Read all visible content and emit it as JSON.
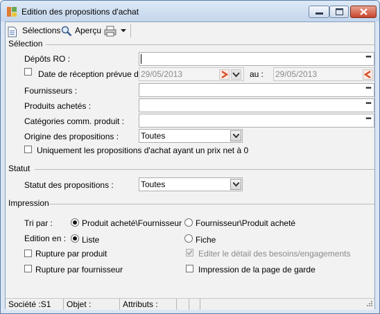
{
  "window": {
    "title": "Edition des propositions d'achat"
  },
  "toolbar": {
    "selections_label": "Sélections",
    "apercu_label": "Aperçu"
  },
  "selection": {
    "title": "Sélection",
    "depots_label": "Dépôts RO :",
    "depots_value": "",
    "date_checkbox_label": "Date de réception prévue du :",
    "date_from": "29/05/2013",
    "date_to_label": "au :",
    "date_to": "29/05/2013",
    "fournisseurs_label": "Fournisseurs :",
    "produits_label": "Produits achetés :",
    "categories_label": "Catégories comm. produit :",
    "origine_label": "Origine des propositions :",
    "origine_value": "Toutes",
    "prix_net_label": "Uniquement les propositions d'achat ayant un prix net à 0"
  },
  "statut": {
    "title": "Statut",
    "statut_label": "Statut des propositions :",
    "statut_value": "Toutes"
  },
  "impression": {
    "title": "Impression",
    "tri_label": "Tri par :",
    "tri_opt1": "Produit acheté\\Fournisseur",
    "tri_opt2": "Fournisseur\\Produit acheté",
    "tri_selected": "Produit acheté\\Fournisseur",
    "edition_label": "Edition en :",
    "edition_opt1": "Liste",
    "edition_opt2": "Fiche",
    "edition_selected": "Liste",
    "rupture_produit": "Rupture par produit",
    "editer_detail": "Editer le détail des besoins/engagements",
    "rupture_fournisseur": "Rupture par fournisseur",
    "page_garde": "Impression de la page de garde"
  },
  "statusbar": {
    "societe": "Société :S1",
    "objet": "Objet :",
    "attributs": "Attributs :"
  },
  "colors": {
    "accent_red": "#d9502b",
    "title_bg": "#c4d6ec"
  }
}
